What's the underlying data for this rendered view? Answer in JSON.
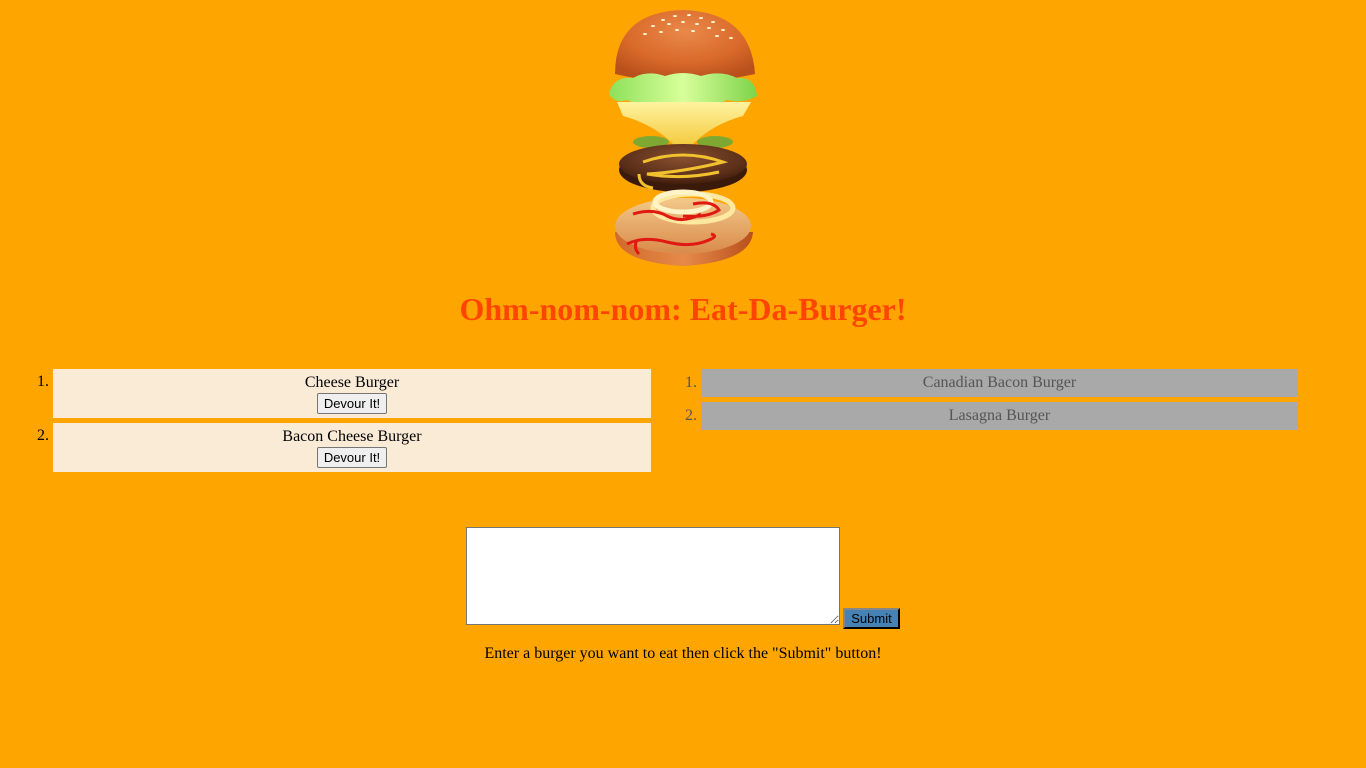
{
  "header": {
    "logo_icon": "burger-illustration-icon",
    "title": "Ohm-nom-nom: Eat-Da-Burger!",
    "title_color": "#FF4500"
  },
  "uneaten": {
    "items": [
      {
        "number": "1.",
        "name": "Cheese Burger",
        "button": "Devour It!"
      },
      {
        "number": "2.",
        "name": "Bacon Cheese Burger",
        "button": "Devour It!"
      }
    ],
    "background": "#FAEBD7"
  },
  "devoured": {
    "items": [
      {
        "number": "1.",
        "name": "Canadian Bacon Burger"
      },
      {
        "number": "2.",
        "name": "Lasagna Burger"
      }
    ],
    "background": "#A9A9A9"
  },
  "form": {
    "input_value": "",
    "submit_label": "Submit",
    "submit_color": "#4682B4",
    "instructions": "Enter a burger you want to eat then click the \"Submit\" button!"
  },
  "page": {
    "background": "#FFA500"
  }
}
